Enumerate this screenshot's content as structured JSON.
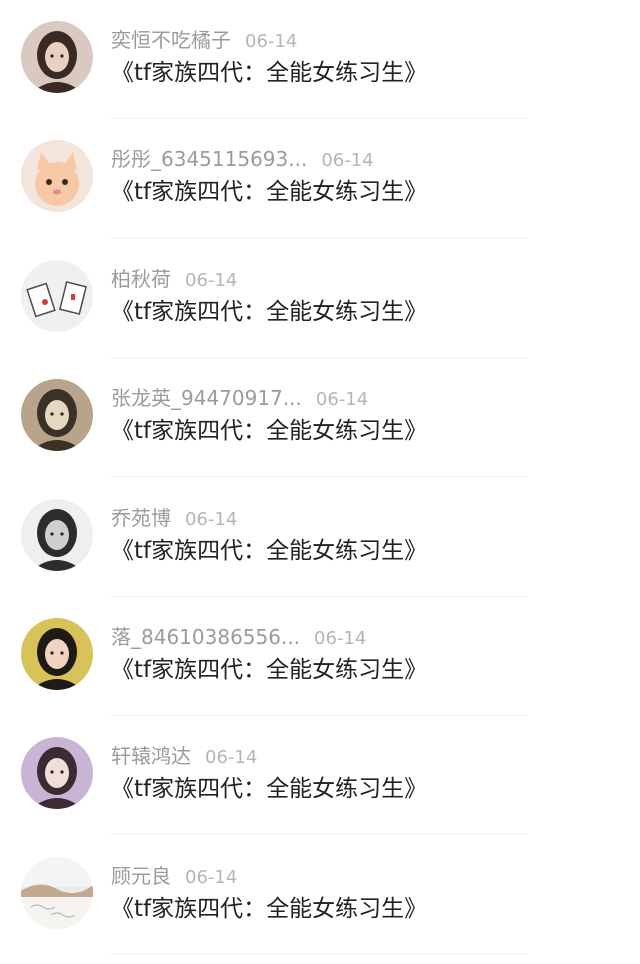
{
  "items": [
    {
      "name": "奕恒不吃橘子",
      "date": "06-14",
      "title": "《tf家族四代：全能女练习生》",
      "avatar": "avatar-girl-long-hair",
      "colors": [
        "#d9c9c1",
        "#3a2a22",
        "#e8d1c2"
      ]
    },
    {
      "name": "彤彤_6345115693...",
      "date": "06-14",
      "title": "《tf家族四代：全能女练习生》",
      "avatar": "avatar-orange-kitten",
      "colors": [
        "#f3e4dc",
        "#e7a46f",
        "#f6c9a4"
      ]
    },
    {
      "name": "柏秋荷",
      "date": "06-14",
      "title": "《tf家族四代：全能女练习生》",
      "avatar": "avatar-cards-sketch",
      "colors": [
        "#f1f0ee",
        "#4a4a4a",
        "#d63a3a"
      ]
    },
    {
      "name": "张龙英_94470917...",
      "date": "06-14",
      "title": "《tf家族四代：全能女练习生》",
      "avatar": "avatar-sepia-portrait",
      "colors": [
        "#b8a48a",
        "#3b3227",
        "#e6d8bf"
      ]
    },
    {
      "name": "乔苑博",
      "date": "06-14",
      "title": "《tf家族四代：全能女练习生》",
      "avatar": "avatar-anime-boy",
      "colors": [
        "#efefef",
        "#2c2c2c",
        "#cfcfcf"
      ]
    },
    {
      "name": "落_84610386556...",
      "date": "06-14",
      "title": "《tf家族四代：全能女练习生》",
      "avatar": "avatar-short-hair-kid",
      "colors": [
        "#d8c25a",
        "#1f1a16",
        "#f0d4bf"
      ]
    },
    {
      "name": "轩辕鸿达",
      "date": "06-14",
      "title": "《tf家族四代：全能女练习生》",
      "avatar": "avatar-purple-girl",
      "colors": [
        "#c9b4d6",
        "#3b2c33",
        "#f1ddd9"
      ]
    },
    {
      "name": "顾元良",
      "date": "06-14",
      "title": "《tf家族四代：全能女练习生》",
      "avatar": "avatar-pale-landscape",
      "colors": [
        "#e9ebe9",
        "#b4bcb8",
        "#c0a98f"
      ]
    }
  ]
}
